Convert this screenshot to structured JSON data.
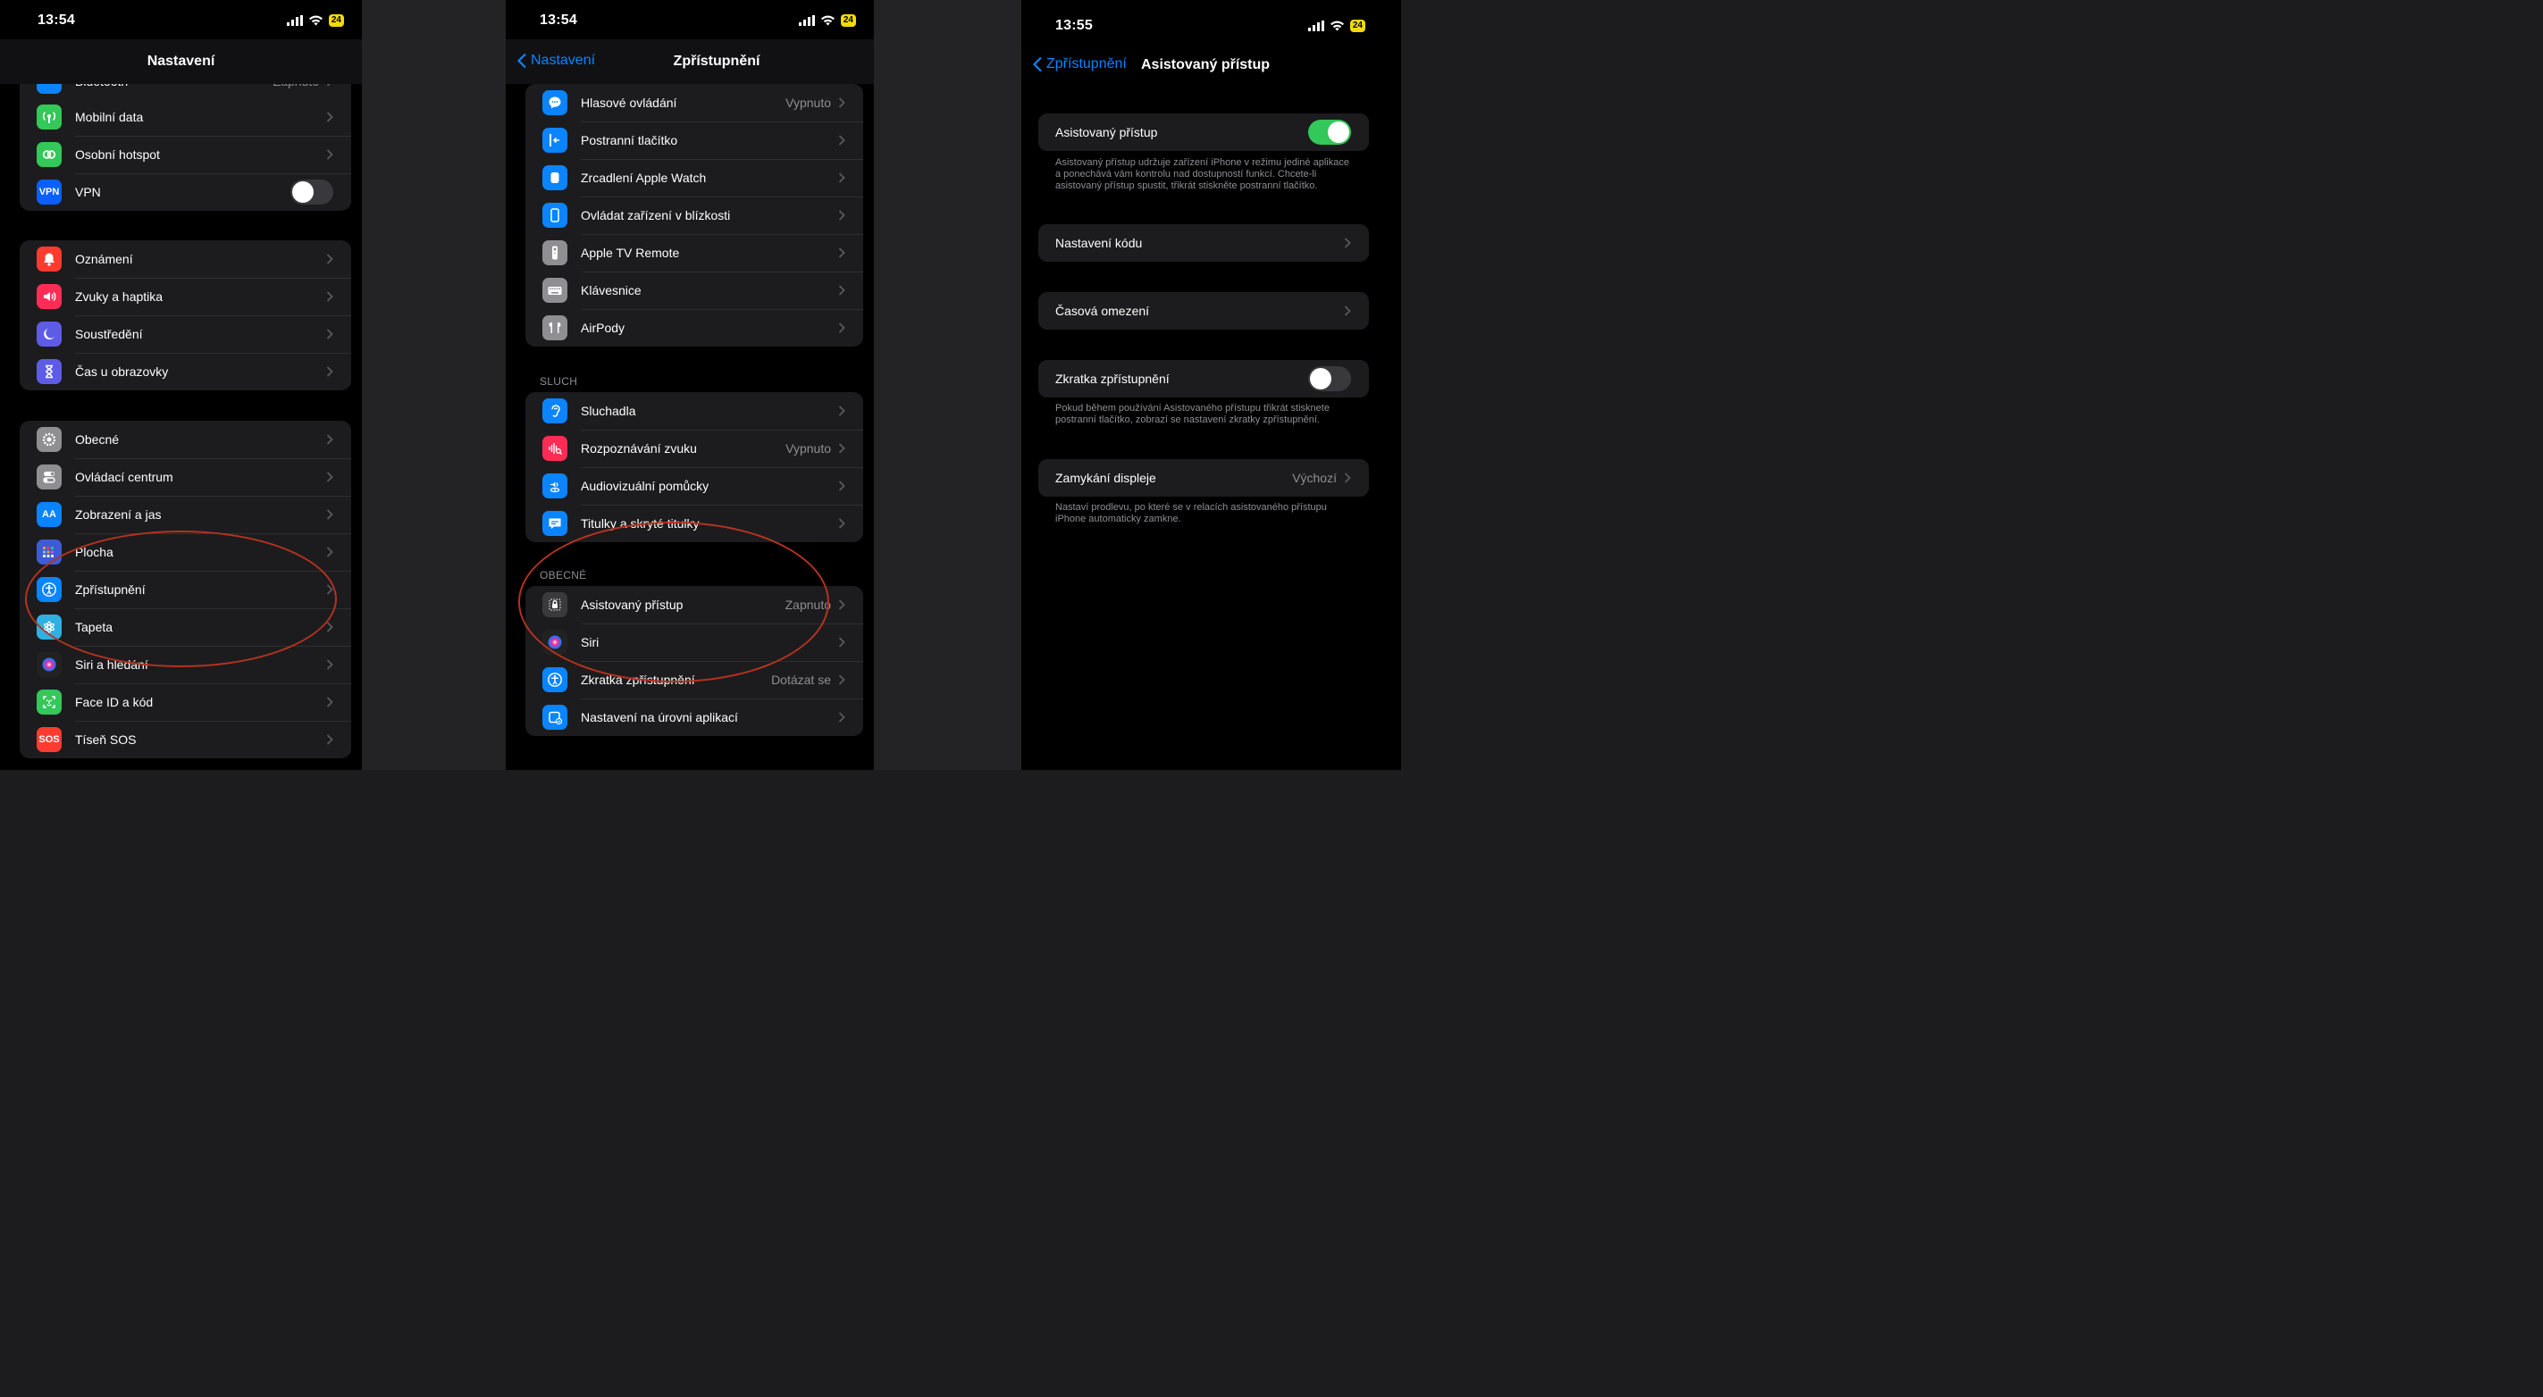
{
  "panel1": {
    "time": "13:54",
    "battery": "24",
    "title": "Nastavení",
    "top_partial": {
      "label": "Bluetooth",
      "value": "Zapnuto"
    },
    "group1": [
      {
        "label": "Mobilní data",
        "icon": "antenna-icon",
        "color": "#34c759"
      },
      {
        "label": "Osobní hotspot",
        "icon": "link-icon",
        "color": "#34c759"
      },
      {
        "label": "VPN",
        "icon": "vpn-icon",
        "color": "#0a60ff",
        "icon_text": "VPN"
      }
    ],
    "group2": [
      {
        "label": "Oznámení",
        "icon": "bell-icon",
        "color": "#ff3b30"
      },
      {
        "label": "Zvuky a haptika",
        "icon": "speaker-icon",
        "color": "#ff2d55"
      },
      {
        "label": "Soustředění",
        "icon": "moon-icon",
        "color": "#5e5ce6"
      },
      {
        "label": "Čas u obrazovky",
        "icon": "hourglass-icon",
        "color": "#5e5ce6"
      }
    ],
    "group3": [
      {
        "label": "Obecné",
        "icon": "gear-icon",
        "color": "#8e8e93"
      },
      {
        "label": "Ovládací centrum",
        "icon": "switches-icon",
        "color": "#8e8e93"
      },
      {
        "label": "Zobrazení a jas",
        "icon": "text-size-icon",
        "color": "#0a84ff",
        "icon_text": "AA"
      },
      {
        "label": "Plocha",
        "icon": "grid-icon",
        "color": "#3e5bd6"
      },
      {
        "label": "Zpřístupnění",
        "icon": "accessibility-icon",
        "color": "#0a84ff"
      },
      {
        "label": "Tapeta",
        "icon": "flower-icon",
        "color": "#30b0e0"
      },
      {
        "label": "Siri a hledání",
        "icon": "siri-icon",
        "color": "#222"
      },
      {
        "label": "Face ID a kód",
        "icon": "face-id-icon",
        "color": "#34c759"
      },
      {
        "label": "Tíseň SOS",
        "icon": "sos-icon",
        "color": "#ff3b30",
        "icon_text": "SOS"
      }
    ]
  },
  "panel2": {
    "time": "13:54",
    "battery": "24",
    "back_label": "Nastavení",
    "title": "Zpřístupnění",
    "group1": [
      {
        "label": "Hlasové ovládání",
        "value": "Vypnuto",
        "icon": "voice-control-icon",
        "color": "#0a84ff"
      },
      {
        "label": "Postranní tlačítko",
        "value": "",
        "icon": "side-button-icon",
        "color": "#0a84ff"
      },
      {
        "label": "Zrcadlení Apple Watch",
        "value": "",
        "icon": "watch-icon",
        "color": "#0a84ff"
      },
      {
        "label": "Ovládat zařízení v blízkosti",
        "value": "",
        "icon": "nearby-device-icon",
        "color": "#0a84ff"
      },
      {
        "label": "Apple TV Remote",
        "value": "",
        "icon": "remote-icon",
        "color": "#8e8e93"
      },
      {
        "label": "Klávesnice",
        "value": "",
        "icon": "keyboard-icon",
        "color": "#8e8e93"
      },
      {
        "label": "AirPody",
        "value": "",
        "icon": "airpods-icon",
        "color": "#8e8e93"
      }
    ],
    "section_hearing": "SLUCH",
    "group2": [
      {
        "label": "Sluchadla",
        "value": "",
        "icon": "ear-icon",
        "color": "#0a84ff"
      },
      {
        "label": "Rozpoznávání zvuku",
        "value": "Vypnuto",
        "icon": "sound-recognition-icon",
        "color": "#ff2d55"
      },
      {
        "label": "Audiovizuální pomůcky",
        "value": "",
        "icon": "audiovisual-icon",
        "color": "#0a84ff"
      },
      {
        "label": "Titulky a skryté titulky",
        "value": "",
        "icon": "subtitles-icon",
        "color": "#0a84ff"
      }
    ],
    "section_general": "OBECNÉ",
    "group3": [
      {
        "label": "Asistovaný přístup",
        "value": "Zapnuto",
        "icon": "lock-icon",
        "color": "#3a3a3c"
      },
      {
        "label": "Siri",
        "value": "",
        "icon": "siri-icon",
        "color": "#222"
      },
      {
        "label": "Zkratka zpřístupnění",
        "value": "Dotázat se",
        "icon": "accessibility-icon",
        "color": "#0a84ff"
      },
      {
        "label": "Nastavení na úrovni aplikací",
        "value": "",
        "icon": "app-settings-icon",
        "color": "#0a84ff"
      }
    ]
  },
  "panel3": {
    "time": "13:55",
    "battery": "24",
    "back_label": "Zpřístupnění",
    "title": "Asistovaný přístup",
    "toggle_row": {
      "label": "Asistovaný přístup",
      "on": true
    },
    "toggle_footer": "Asistovaný přístup udržuje zařízení iPhone v režimu jediné aplikace a ponechává vám kontrolu nad dostupností funkcí. Chcete-li asistovaný přístup spustit, třikrát stiskněte postranní tlačítko.",
    "passcode_row": "Nastavení kódu",
    "time_limits_row": "Časová omezení",
    "shortcut_row": {
      "label": "Zkratka zpřístupnění",
      "on": false
    },
    "shortcut_footer": "Pokud během používání Asistovaného přístupu třikrát stisknete postranní tlačítko, zobrazí se nastavení zkratky zpřístupnění.",
    "lock_row": {
      "label": "Zamykání displeje",
      "value": "Výchozí"
    },
    "lock_footer": "Nastaví prodlevu, po které se v relacích asistovaného přístupu iPhone automaticky zamkne."
  },
  "colors": {
    "accent": "#0a84ff",
    "toggle_on": "#34c759",
    "annotation": "#b5321f"
  }
}
